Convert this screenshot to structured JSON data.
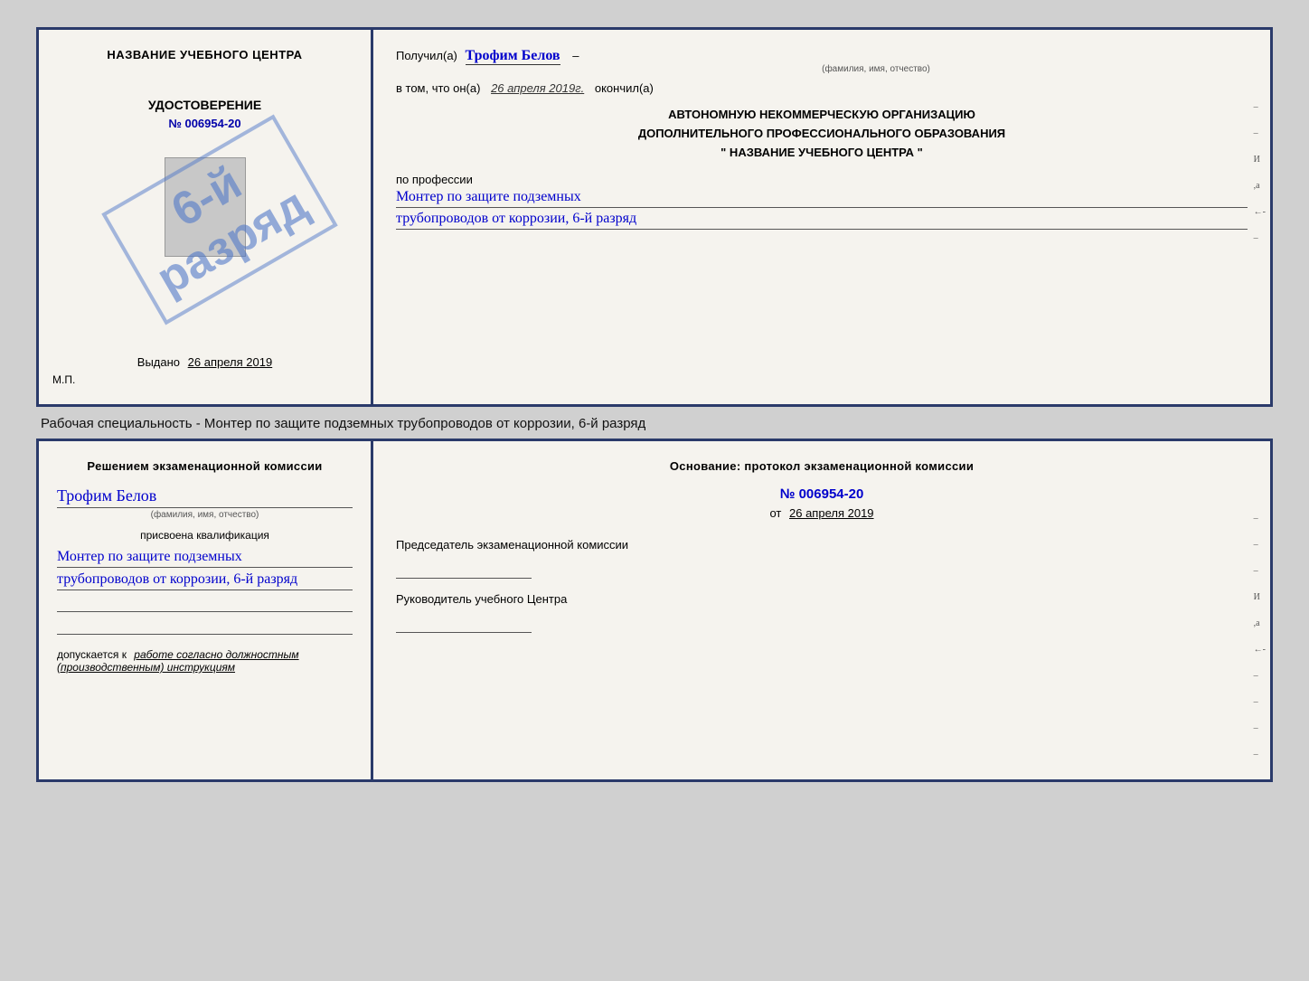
{
  "page": {
    "background": "#d0d0d0"
  },
  "caption": {
    "text": "Рабочая специальность - Монтер по защите подземных трубопроводов от коррозии, 6-й разряд"
  },
  "cert_top": {
    "left": {
      "org_name": "НАЗВАНИЕ УЧЕБНОГО ЦЕНТРА",
      "cert_label": "УДОСТОВЕРЕНИЕ",
      "cert_number": "№ 006954-20",
      "issued_label": "Выдано",
      "issued_date": "26 апреля 2019",
      "mp_label": "М.П."
    },
    "stamp": {
      "line1": "6-й",
      "line2": "разряд"
    },
    "right": {
      "received_prefix": "Получил(а)",
      "receiver_name": "Трофим Белов",
      "name_subtitle": "(фамилия, имя, отчество)",
      "in_that_prefix": "в том, что он(а)",
      "completed_date": "26 апреля 2019г.",
      "completed_suffix": "окончил(а)",
      "org_line1": "АВТОНОМНУЮ НЕКОММЕРЧЕСКУЮ ОРГАНИЗАЦИЮ",
      "org_line2": "ДОПОЛНИТЕЛЬНОГО ПРОФЕССИОНАЛЬНОГО ОБРАЗОВАНИЯ",
      "org_line3": "\" НАЗВАНИЕ УЧЕБНОГО ЦЕНТРА \"",
      "profession_label": "по профессии",
      "profession_line1": "Монтер по защите подземных",
      "profession_line2": "трубопроводов от коррозии, 6-й разряд"
    },
    "side_marks": [
      "-",
      "-",
      "И",
      ",а",
      "←"
    ]
  },
  "cert_bottom": {
    "left": {
      "decision_text": "Решением экзаменационной комиссии",
      "person_name": "Трофим Белов",
      "name_subtitle": "(фамилия, имя, отчество)",
      "assigned_label": "присвоена квалификация",
      "qualification_line1": "Монтер по защите подземных",
      "qualification_line2": "трубопроводов от коррозии, 6-й разряд",
      "allowed_prefix": "допускается к",
      "allowed_text": "работе согласно должностным (производственным) инструкциям"
    },
    "right": {
      "basis_text": "Основание: протокол экзаменационной комиссии",
      "protocol_number": "№ 006954-20",
      "from_prefix": "от",
      "from_date": "26 апреля 2019",
      "commission_chair_label": "Председатель экзаменационной комиссии",
      "head_label": "Руководитель учебного Центра"
    },
    "side_marks": [
      "-",
      "-",
      "-",
      "И",
      ",а",
      "←",
      "-",
      "-",
      "-",
      "-"
    ]
  }
}
